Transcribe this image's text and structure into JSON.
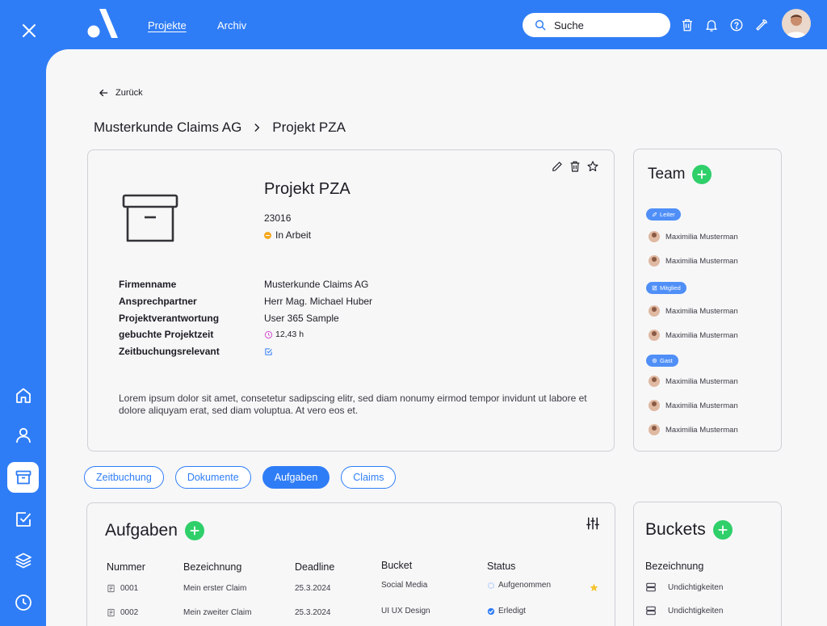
{
  "topbar": {
    "nav": [
      {
        "label": "Projekte",
        "active": true
      },
      {
        "label": "Archiv",
        "active": false
      }
    ],
    "search_placeholder": "Suche"
  },
  "sidebar": {
    "items": [
      "close-icon",
      "home-icon",
      "user-icon",
      "archive-icon",
      "checkbox-icon",
      "layers-icon",
      "clock-icon"
    ],
    "active": "archive-icon"
  },
  "back_label": "Zurück",
  "breadcrumb": {
    "customer": "Musterkunde Claims AG",
    "project": "Projekt PZA"
  },
  "project": {
    "title": "Projekt PZA",
    "number": "23016",
    "status": "In Arbeit",
    "status_color": "#f4a81d",
    "details": [
      {
        "label": "Firmenname",
        "value": "Musterkunde Claims AG"
      },
      {
        "label": "Ansprechpartner",
        "value": "Herr Mag. Michael Huber"
      },
      {
        "label": "Projektverantwortung",
        "value": "User 365 Sample"
      },
      {
        "label": "gebuchte Projektzeit",
        "value": "12,43 h",
        "icon": "clock-icon"
      },
      {
        "label": "Zeitbuchungsrelevant",
        "value": "",
        "icon": "checkbox-checked-icon"
      }
    ],
    "description": "Lorem ipsum dolor sit amet, consetetur sadipscing elitr, sed diam nonumy eirmod tempor invidunt ut labore et dolore  aliquyam erat, sed diam voluptua. At vero eos et."
  },
  "team": {
    "title": "Team",
    "groups": [
      {
        "role": "Leiter",
        "members": [
          "Maximilia Musterman",
          "Maximilia Musterman"
        ]
      },
      {
        "role": "Mitglied",
        "members": [
          "Maximilia Musterman",
          "Maximilia Musterman"
        ]
      },
      {
        "role": "Gast",
        "members": [
          "Maximilia Musterman",
          "Maximilia Musterman",
          "Maximilia Musterman"
        ]
      }
    ]
  },
  "tabs": [
    {
      "label": "Zeitbuchung",
      "active": false
    },
    {
      "label": "Dokumente",
      "active": false
    },
    {
      "label": "Aufgaben",
      "active": true
    },
    {
      "label": "Claims",
      "active": false
    }
  ],
  "tasks": {
    "title": "Aufgaben",
    "columns": [
      "Nummer",
      "Bezeichnung",
      "Deadline",
      "Bucket",
      "Status"
    ],
    "rows": [
      {
        "number": "0001",
        "name": "Mein erster Claim",
        "deadline": "25.3.2024",
        "bucket": "Social Media",
        "status": "Aufgenommen",
        "starred": true
      },
      {
        "number": "0002",
        "name": "Mein zweiter Claim",
        "deadline": "25.3.2024",
        "bucket": "UI UX Design",
        "status": "Erledigt",
        "starred": false
      }
    ]
  },
  "buckets": {
    "title": "Buckets",
    "column": "Bezeichnung",
    "rows": [
      "Undichtigkeiten",
      "Undichtigkeiten"
    ]
  },
  "colors": {
    "brand": "#2f7df6",
    "add": "#2fcf6a",
    "star": "#f5c531",
    "done": "#2f7df6"
  }
}
